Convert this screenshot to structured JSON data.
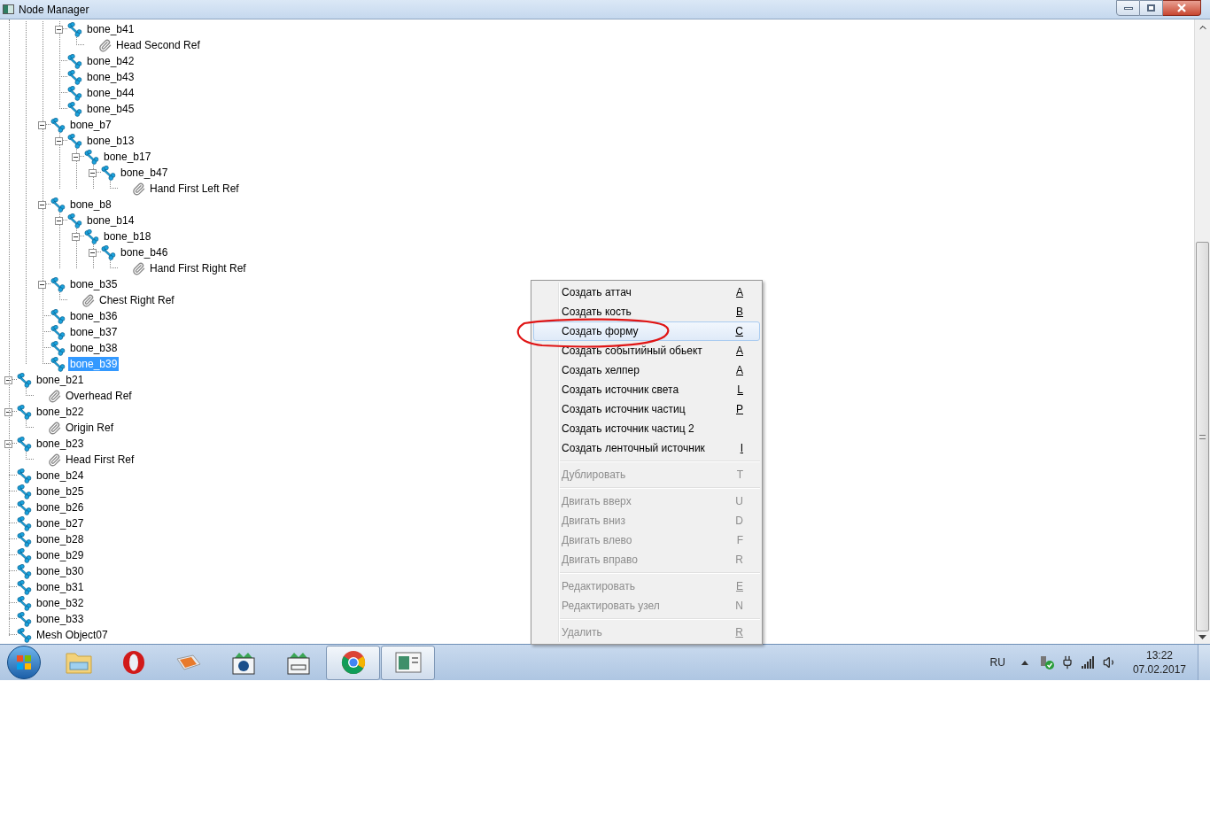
{
  "window": {
    "title": "Node Manager"
  },
  "tree": [
    {
      "children": [
        {
          "children": [
            {
              "children": [
                {
                  "label": "bone_b41",
                  "kind": "bone",
                  "selected": false,
                  "expanded": true,
                  "children": [
                    {
                      "label": "Head Second Ref",
                      "kind": "ref",
                      "selected": false
                    }
                  ]
                },
                {
                  "label": "bone_b42",
                  "kind": "bone",
                  "selected": false
                },
                {
                  "label": "bone_b43",
                  "kind": "bone",
                  "selected": false
                },
                {
                  "label": "bone_b44",
                  "kind": "bone",
                  "selected": false
                },
                {
                  "label": "bone_b45",
                  "kind": "bone",
                  "selected": false
                }
              ]
            },
            {
              "label": "bone_b7",
              "kind": "bone",
              "selected": false,
              "expanded": true,
              "children": [
                {
                  "label": "bone_b13",
                  "kind": "bone",
                  "selected": false,
                  "expanded": true,
                  "children": [
                    {
                      "label": "bone_b17",
                      "kind": "bone",
                      "selected": false,
                      "expanded": true,
                      "children": [
                        {
                          "label": "bone_b47",
                          "kind": "bone",
                          "selected": false,
                          "expanded": true,
                          "children": [
                            {
                              "label": "Hand First Left Ref",
                              "kind": "ref",
                              "selected": false
                            }
                          ]
                        }
                      ]
                    }
                  ]
                }
              ]
            },
            {
              "label": "bone_b8",
              "kind": "bone",
              "selected": false,
              "expanded": true,
              "children": [
                {
                  "label": "bone_b14",
                  "kind": "bone",
                  "selected": false,
                  "expanded": true,
                  "children": [
                    {
                      "label": "bone_b18",
                      "kind": "bone",
                      "selected": false,
                      "expanded": true,
                      "children": [
                        {
                          "label": "bone_b46",
                          "kind": "bone",
                          "selected": false,
                          "expanded": true,
                          "children": [
                            {
                              "label": "Hand First Right Ref",
                              "kind": "ref",
                              "selected": false
                            }
                          ]
                        }
                      ]
                    }
                  ]
                }
              ]
            },
            {
              "label": "bone_b35",
              "kind": "bone",
              "selected": false,
              "expanded": true,
              "children": [
                {
                  "label": "Chest Right Ref",
                  "kind": "ref",
                  "selected": false
                }
              ]
            },
            {
              "label": "bone_b36",
              "kind": "bone",
              "selected": false
            },
            {
              "label": "bone_b37",
              "kind": "bone",
              "selected": false
            },
            {
              "label": "bone_b38",
              "kind": "bone",
              "selected": false
            },
            {
              "label": "bone_b39",
              "kind": "bone",
              "selected": true
            }
          ]
        }
      ]
    },
    {
      "label": "bone_b21",
      "kind": "bone",
      "selected": false,
      "expanded": true,
      "children": [
        {
          "label": "Overhead Ref",
          "kind": "ref",
          "selected": false
        }
      ]
    },
    {
      "label": "bone_b22",
      "kind": "bone",
      "selected": false,
      "expanded": true,
      "children": [
        {
          "label": "Origin Ref",
          "kind": "ref",
          "selected": false
        }
      ]
    },
    {
      "label": "bone_b23",
      "kind": "bone",
      "selected": false,
      "expanded": true,
      "children": [
        {
          "label": "Head First Ref",
          "kind": "ref",
          "selected": false
        }
      ]
    },
    {
      "label": "bone_b24",
      "kind": "bone",
      "selected": false
    },
    {
      "label": "bone_b25",
      "kind": "bone",
      "selected": false
    },
    {
      "label": "bone_b26",
      "kind": "bone",
      "selected": false
    },
    {
      "label": "bone_b27",
      "kind": "bone",
      "selected": false
    },
    {
      "label": "bone_b28",
      "kind": "bone",
      "selected": false
    },
    {
      "label": "bone_b29",
      "kind": "bone",
      "selected": false
    },
    {
      "label": "bone_b30",
      "kind": "bone",
      "selected": false
    },
    {
      "label": "bone_b31",
      "kind": "bone",
      "selected": false
    },
    {
      "label": "bone_b32",
      "kind": "bone",
      "selected": false
    },
    {
      "label": "bone_b33",
      "kind": "bone",
      "selected": false
    },
    {
      "label": "Mesh Object07",
      "kind": "bone",
      "selected": false
    }
  ],
  "context_menu": {
    "groups": [
      [
        {
          "label": "Создать аттач",
          "shortcut": "A",
          "underlined": true,
          "disabled": false,
          "selected": false
        },
        {
          "label": "Создать кость",
          "shortcut": "B",
          "underlined": true,
          "disabled": false,
          "selected": false
        },
        {
          "label": "Создать форму",
          "shortcut": "C",
          "underlined": true,
          "disabled": false,
          "selected": true
        },
        {
          "label": "Создать событийный обьект",
          "shortcut": "A",
          "underlined": true,
          "disabled": false,
          "selected": false
        },
        {
          "label": "Создать хелпер",
          "shortcut": "A",
          "underlined": true,
          "disabled": false,
          "selected": false
        },
        {
          "label": "Создать источник света",
          "shortcut": "L",
          "underlined": true,
          "disabled": false,
          "selected": false
        },
        {
          "label": "Создать источник частиц",
          "shortcut": "P",
          "underlined": true,
          "disabled": false,
          "selected": false
        },
        {
          "label": "Создать источник частиц 2",
          "disabled": false,
          "selected": false
        },
        {
          "label": "Создать ленточный источник",
          "shortcut": "I",
          "underlined": true,
          "disabled": false,
          "selected": false
        }
      ],
      [
        {
          "label": "Дублировать",
          "shortcut": "T",
          "underlined": false,
          "disabled": true,
          "selected": false
        }
      ],
      [
        {
          "label": "Двигать вверх",
          "shortcut": "U",
          "underlined": false,
          "disabled": true,
          "selected": false
        },
        {
          "label": "Двигать вниз",
          "shortcut": "D",
          "underlined": false,
          "disabled": true,
          "selected": false
        },
        {
          "label": "Двигать влево",
          "shortcut": "F",
          "underlined": false,
          "disabled": true,
          "selected": false
        },
        {
          "label": "Двигать вправо",
          "shortcut": "R",
          "underlined": false,
          "disabled": true,
          "selected": false
        }
      ],
      [
        {
          "label": "Редактировать",
          "shortcut": "E",
          "underlined": true,
          "disabled": true,
          "selected": false
        },
        {
          "label": "Редактировать узел",
          "shortcut": "N",
          "underlined": false,
          "disabled": true,
          "selected": false
        }
      ],
      [
        {
          "label": "Удалить",
          "shortcut": "R",
          "underlined": true,
          "disabled": true,
          "selected": false
        }
      ]
    ]
  },
  "taskbar": {
    "apps": [
      {
        "kind": "folder",
        "active": false
      },
      {
        "kind": "opera",
        "active": false
      },
      {
        "kind": "photo",
        "active": false
      },
      {
        "kind": "hp",
        "active": false
      },
      {
        "kind": "scanner",
        "active": false
      },
      {
        "kind": "chrome",
        "active": true
      },
      {
        "kind": "window",
        "active": true
      }
    ],
    "tray": {
      "language": "RU",
      "time": "13:22",
      "date": "07.02.2017"
    }
  }
}
